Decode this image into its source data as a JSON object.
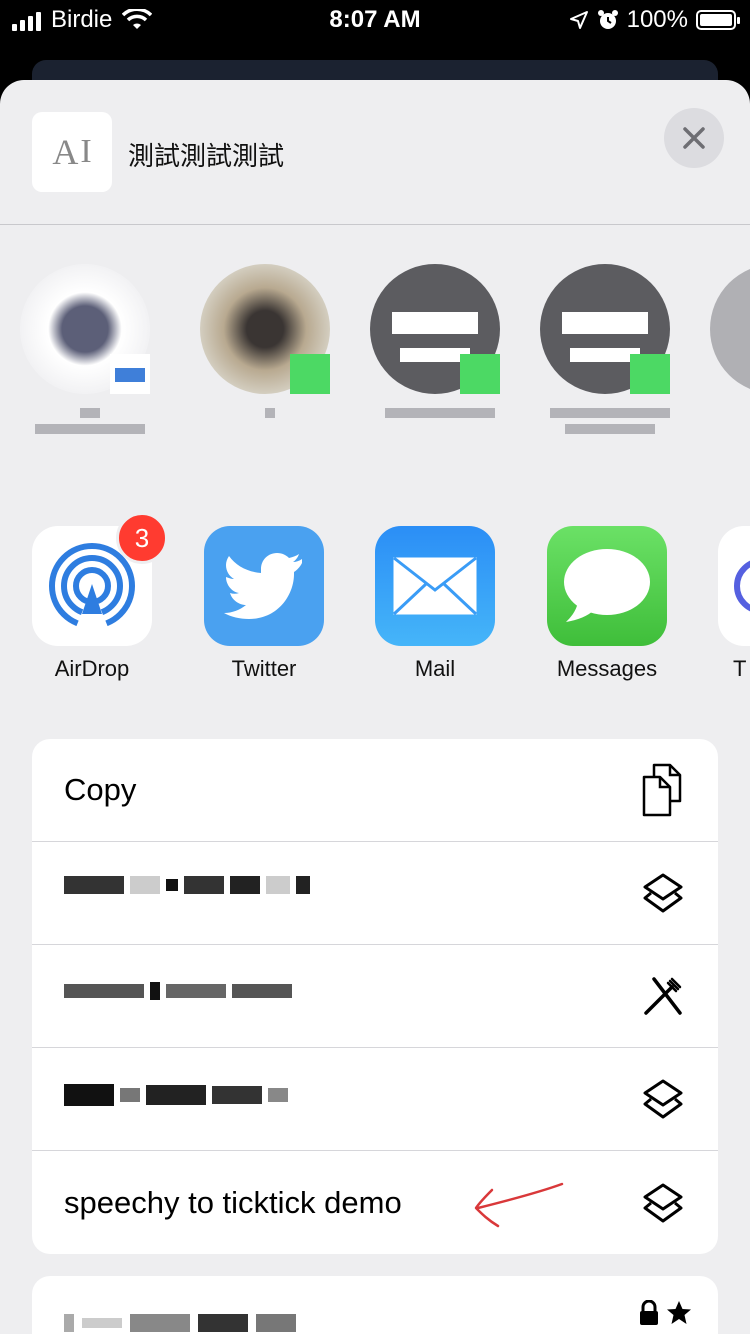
{
  "status_bar": {
    "carrier": "Birdie",
    "time": "8:07 AM",
    "battery": "100%"
  },
  "header": {
    "thumbnail_text": "A",
    "title": "測試測試測試"
  },
  "apps": [
    {
      "label": "AirDrop",
      "badge": "3"
    },
    {
      "label": "Twitter"
    },
    {
      "label": "Mail"
    },
    {
      "label": "Messages"
    },
    {
      "label": "T"
    }
  ],
  "actions": [
    {
      "label": "Copy",
      "icon": "copy-icon"
    },
    {
      "label": "",
      "icon": "layers-icon"
    },
    {
      "label": "",
      "icon": "utensils-icon"
    },
    {
      "label": "",
      "icon": "layers-icon"
    },
    {
      "label": "speechy to ticktick demo",
      "icon": "layers-icon"
    }
  ],
  "colors": {
    "sheet": "#eeeef0",
    "airdrop_blue": "#2e7de0",
    "twitter_blue": "#4aa1f0",
    "messages_green": "#52d14e",
    "badge_red": "#ff3b30"
  }
}
